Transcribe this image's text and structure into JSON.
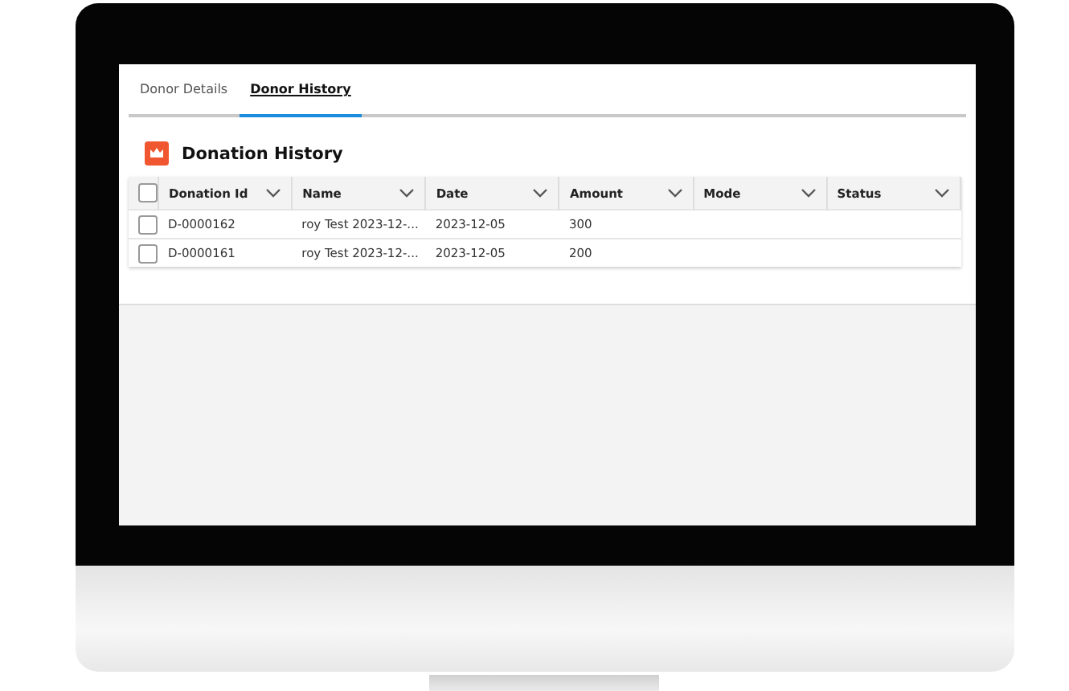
{
  "tabs": [
    {
      "label": "Donor Details",
      "selected": false
    },
    {
      "label": "Donor History",
      "selected": true
    }
  ],
  "card": {
    "title": "Donation History"
  },
  "table": {
    "select_all_checked": false,
    "columns": [
      "Donation Id",
      "Name",
      "Date",
      "Amount",
      "Mode",
      "Status"
    ],
    "rows": [
      {
        "checked": false,
        "cells": [
          "D-0000162",
          "roy Test 2023-12-...",
          "2023-12-05",
          "300",
          "",
          ""
        ]
      },
      {
        "checked": false,
        "cells": [
          "D-0000161",
          "roy Test 2023-12-...",
          "2023-12-05",
          "200",
          "",
          ""
        ]
      }
    ]
  }
}
